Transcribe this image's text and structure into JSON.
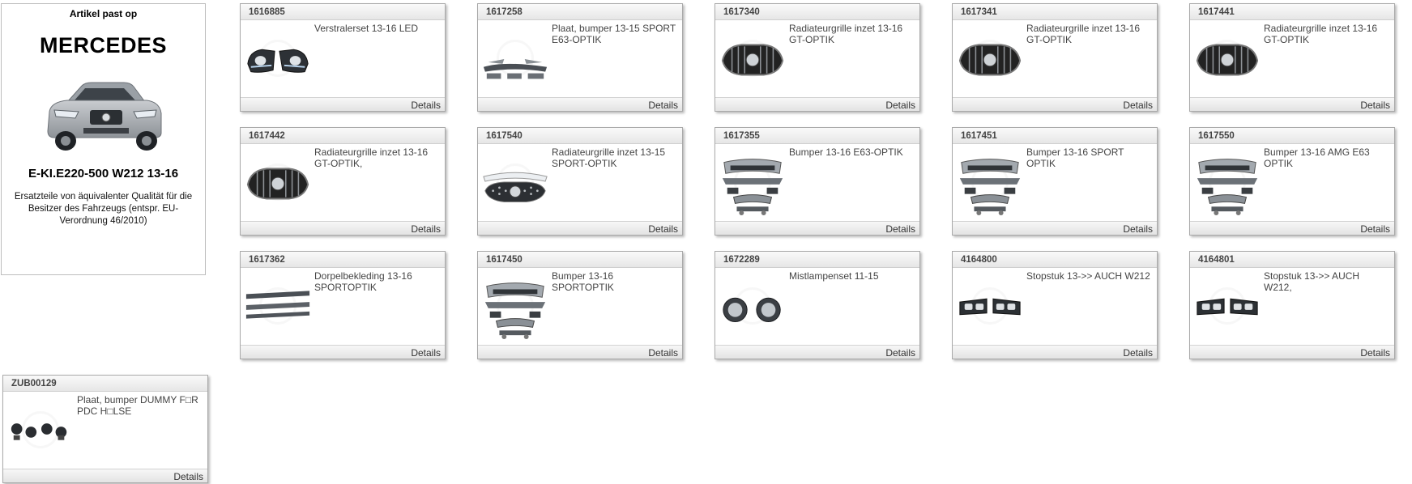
{
  "vehicle": {
    "heading": "Artikel past op",
    "brand": "MERCEDES",
    "model": "E-KI.E220-500 W212 13-16",
    "note": "Ersatzteile von äquivalenter Qualität für die Besitzer des Fahrzeugs (entspr. EU-Verordnung 46/2010)"
  },
  "products": [
    {
      "code": "1616885",
      "desc": "Verstralerset 13-16 LED",
      "details": "Details",
      "thumb": "headlight"
    },
    {
      "code": "1617258",
      "desc": "Plaat, bumper 13-15 SPORT E63-OPTIK",
      "details": "Details",
      "thumb": "bumperplate"
    },
    {
      "code": "1617340",
      "desc": "Radiateurgrille inzet 13-16 GT-OPTIK",
      "details": "Details",
      "thumb": "grille"
    },
    {
      "code": "1617341",
      "desc": "Radiateurgrille inzet 13-16 GT-OPTIK",
      "details": "Details",
      "thumb": "grille"
    },
    {
      "code": "1617441",
      "desc": "Radiateurgrille inzet 13-16 GT-OPTIK",
      "details": "Details",
      "thumb": "grille"
    },
    {
      "code": "1617442",
      "desc": "Radiateurgrille inzet 13-16 GT-OPTIK,",
      "details": "Details",
      "thumb": "grille"
    },
    {
      "code": "1617540",
      "desc": "Radiateurgrille inzet 13-15 SPORT-OPTIK",
      "details": "Details",
      "thumb": "grille2"
    },
    {
      "code": "1617355",
      "desc": "Bumper 13-16 E63-OPTIK",
      "details": "Details",
      "thumb": "bumperkit"
    },
    {
      "code": "1617451",
      "desc": "Bumper 13-16 SPORT OPTIK",
      "details": "Details",
      "thumb": "bumperkit"
    },
    {
      "code": "1617550",
      "desc": "Bumper 13-16 AMG E63 OPTIK",
      "details": "Details",
      "thumb": "bumperkit"
    },
    {
      "code": "1617362",
      "desc": "Dorpelbekleding 13-16 SPORTOPTIK",
      "details": "Details",
      "thumb": "sills"
    },
    {
      "code": "1617450",
      "desc": "Bumper 13-16 SPORTOPTIK",
      "details": "Details",
      "thumb": "bumperkit"
    },
    {
      "code": "1672289",
      "desc": "Mistlampenset 11-15",
      "details": "Details",
      "thumb": "foglights"
    },
    {
      "code": "4164800",
      "desc": "Stopstuk 13->> AUCH W212",
      "details": "Details",
      "thumb": "tips"
    },
    {
      "code": "4164801",
      "desc": "Stopstuk 13->> AUCH W212,",
      "details": "Details",
      "thumb": "tips"
    },
    {
      "code": "ZUB00129",
      "desc": "Plaat, bumper DUMMY F□R PDC H□LSE",
      "details": "Details",
      "thumb": "pdc"
    }
  ]
}
